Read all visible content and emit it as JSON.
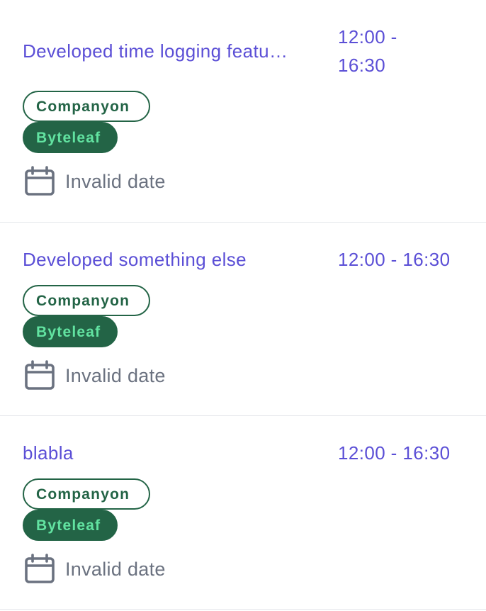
{
  "entries": [
    {
      "title": "Developed time logging featu…",
      "time": "12:00 - 16:30",
      "tags": [
        "Companyon",
        "Byteleaf"
      ],
      "date": "Invalid date"
    },
    {
      "title": "Developed something else",
      "time": "12:00 - 16:30",
      "tags": [
        "Companyon",
        "Byteleaf"
      ],
      "date": "Invalid date"
    },
    {
      "title": "blabla",
      "time": "12:00 - 16:30",
      "tags": [
        "Companyon",
        "Byteleaf"
      ],
      "date": "Invalid date"
    }
  ],
  "colors": {
    "title": "#5b4fd6",
    "tag_primary": "#236446",
    "tag_filled_text": "#62e3a1",
    "muted_text": "#6b7280",
    "divider": "#e5e7eb"
  },
  "icons": {
    "date": "calendar-icon"
  }
}
